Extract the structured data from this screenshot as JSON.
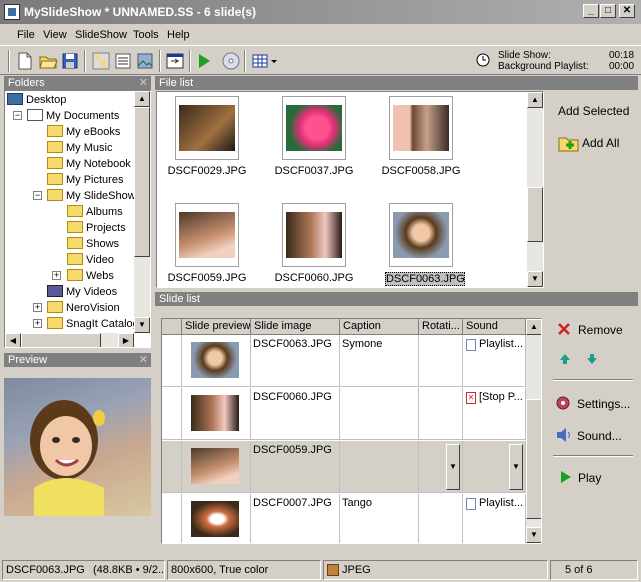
{
  "window": {
    "title": "MySlideShow * UNNAMED.SS - 6 slide(s)"
  },
  "menu": [
    "File",
    "View",
    "SlideShow",
    "Tools",
    "Help"
  ],
  "toolbar": {
    "status": {
      "slideshow_label": "Slide Show:",
      "slideshow_time": "00:18",
      "playlist_label": "Background Playlist:",
      "playlist_time": "00:00"
    }
  },
  "folders": {
    "title": "Folders",
    "items": [
      {
        "label": "Desktop"
      },
      {
        "label": "My Documents"
      },
      {
        "label": "My eBooks"
      },
      {
        "label": "My Music"
      },
      {
        "label": "My Notebook"
      },
      {
        "label": "My Pictures"
      },
      {
        "label": "My SlideShow"
      },
      {
        "label": "Albums"
      },
      {
        "label": "Projects"
      },
      {
        "label": "Shows"
      },
      {
        "label": "Video"
      },
      {
        "label": "Webs"
      },
      {
        "label": "My Videos"
      },
      {
        "label": "NeroVision"
      },
      {
        "label": "SnagIt Catalog"
      }
    ]
  },
  "preview": {
    "title": "Preview"
  },
  "filelist": {
    "title": "File list",
    "files": [
      {
        "name": "DSCF0029.JPG"
      },
      {
        "name": "DSCF0037.JPG"
      },
      {
        "name": "DSCF0058.JPG"
      },
      {
        "name": "DSCF0059.JPG"
      },
      {
        "name": "DSCF0060.JPG"
      },
      {
        "name": "DSCF0063.JPG"
      }
    ],
    "add_selected": "Add Selected",
    "add_all": "Add All"
  },
  "slidelist": {
    "title": "Slide list",
    "columns": [
      "Slide preview",
      "Slide image",
      "Caption",
      "Rotati...",
      "Sound"
    ],
    "rows": [
      {
        "image": "DSCF0063.JPG",
        "caption": "Symone",
        "rotation": "",
        "sound": "Playlist..."
      },
      {
        "image": "DSCF0060.JPG",
        "caption": "",
        "rotation": "",
        "sound": "[Stop P..."
      },
      {
        "image": "DSCF0059.JPG",
        "caption": "",
        "rotation": "",
        "sound": ""
      },
      {
        "image": "DSCF0007.JPG",
        "caption": "Tango",
        "rotation": "",
        "sound": "Playlist..."
      }
    ],
    "actions": {
      "remove": "Remove",
      "settings": "Settings...",
      "sound": "Sound...",
      "play": "Play"
    }
  },
  "statusbar": {
    "file": "DSCF0063.JPG",
    "info": "(48.8KB • 9/2...",
    "resolution": "800x600, True color",
    "format": "JPEG",
    "page": "5 of 6"
  }
}
